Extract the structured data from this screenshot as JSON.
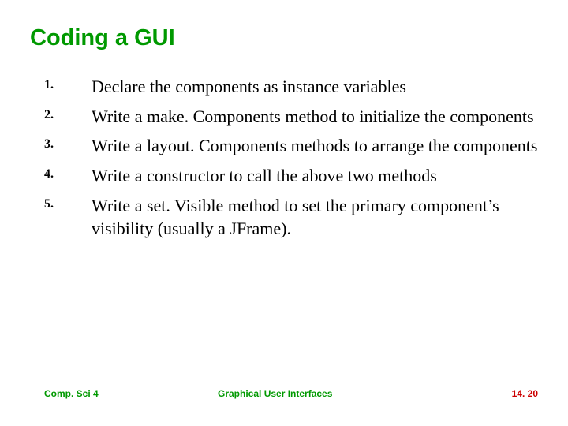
{
  "title": "Coding a GUI",
  "items": [
    {
      "num": "1.",
      "text": "Declare the components as instance variables"
    },
    {
      "num": "2.",
      "text": "Write a make. Components method to initialize the components"
    },
    {
      "num": "3.",
      "text": "Write a layout. Components methods to arrange the components"
    },
    {
      "num": "4.",
      "text": "Write a constructor to call the above two methods"
    },
    {
      "num": "5.",
      "text": "Write a set. Visible method to set the primary component’s visibility (usually a JFrame)."
    }
  ],
  "footer": {
    "left": "Comp. Sci 4",
    "center": "Graphical User Interfaces",
    "right": "14. 20"
  }
}
